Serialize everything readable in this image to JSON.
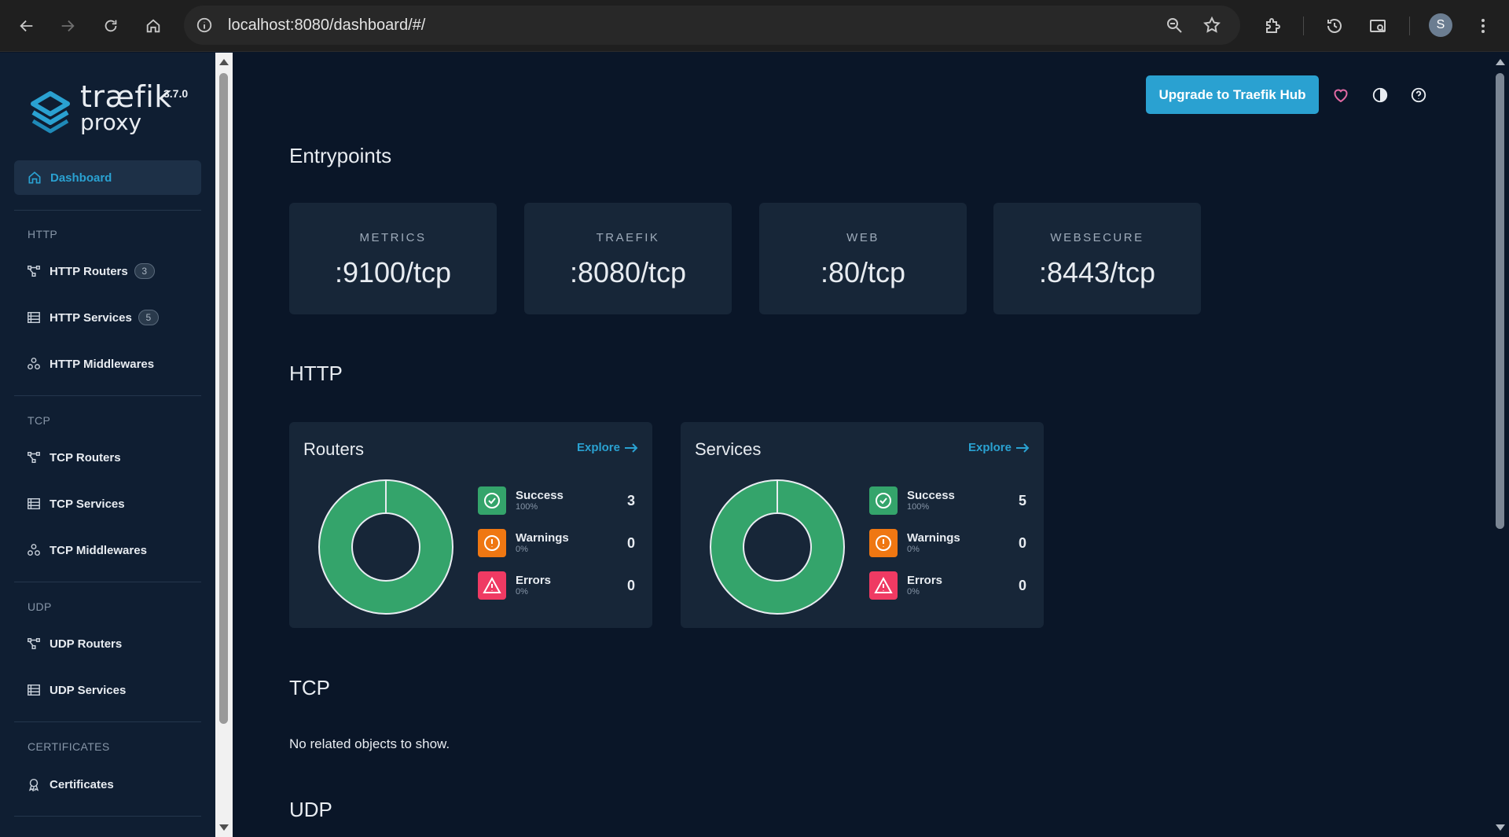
{
  "browser": {
    "url": "localhost:8080/dashboard/#/"
  },
  "sidebar": {
    "logo": {
      "word1": "træfik",
      "word2": "proxy",
      "version": "3.7.0"
    },
    "dashboard_label": "Dashboard",
    "sections": [
      {
        "title": "HTTP",
        "items": [
          {
            "label": "HTTP Routers",
            "badge": "3",
            "icon": "routers-icon"
          },
          {
            "label": "HTTP Services",
            "badge": "5",
            "icon": "services-icon"
          },
          {
            "label": "HTTP Middlewares",
            "badge": "",
            "icon": "middlewares-icon"
          }
        ]
      },
      {
        "title": "TCP",
        "items": [
          {
            "label": "TCP Routers",
            "badge": "",
            "icon": "routers-icon"
          },
          {
            "label": "TCP Services",
            "badge": "",
            "icon": "services-icon"
          },
          {
            "label": "TCP Middlewares",
            "badge": "",
            "icon": "middlewares-icon"
          }
        ]
      },
      {
        "title": "UDP",
        "items": [
          {
            "label": "UDP Routers",
            "badge": "",
            "icon": "routers-icon"
          },
          {
            "label": "UDP Services",
            "badge": "",
            "icon": "services-icon"
          }
        ]
      },
      {
        "title": "CERTIFICATES",
        "items": [
          {
            "label": "Certificates",
            "badge": "",
            "icon": "certificate-icon"
          }
        ]
      }
    ]
  },
  "header": {
    "upgrade_label": "Upgrade to Traefik Hub"
  },
  "main": {
    "entrypoints_title": "Entrypoints",
    "entrypoints": [
      {
        "name": "METRICS",
        "address": ":9100/tcp"
      },
      {
        "name": "TRAEFIK",
        "address": ":8080/tcp"
      },
      {
        "name": "WEB",
        "address": ":80/tcp"
      },
      {
        "name": "WEBSECURE",
        "address": ":8443/tcp"
      }
    ],
    "http_title": "HTTP",
    "cards": [
      {
        "title": "Routers",
        "explore": "Explore",
        "stats": [
          {
            "label": "Success",
            "pct": "100%",
            "count": "3"
          },
          {
            "label": "Warnings",
            "pct": "0%",
            "count": "0"
          },
          {
            "label": "Errors",
            "pct": "0%",
            "count": "0"
          }
        ],
        "success_fraction": 1.0
      },
      {
        "title": "Services",
        "explore": "Explore",
        "stats": [
          {
            "label": "Success",
            "pct": "100%",
            "count": "5"
          },
          {
            "label": "Warnings",
            "pct": "0%",
            "count": "0"
          },
          {
            "label": "Errors",
            "pct": "0%",
            "count": "0"
          }
        ],
        "success_fraction": 1.0
      }
    ],
    "tcp_title": "TCP",
    "tcp_empty": "No related objects to show.",
    "udp_title": "UDP"
  },
  "colors": {
    "accent": "#2aa1d1",
    "success": "#34a46b",
    "warning": "#ef7712",
    "error": "#ef3a63",
    "favorite": "#e36aa4"
  }
}
